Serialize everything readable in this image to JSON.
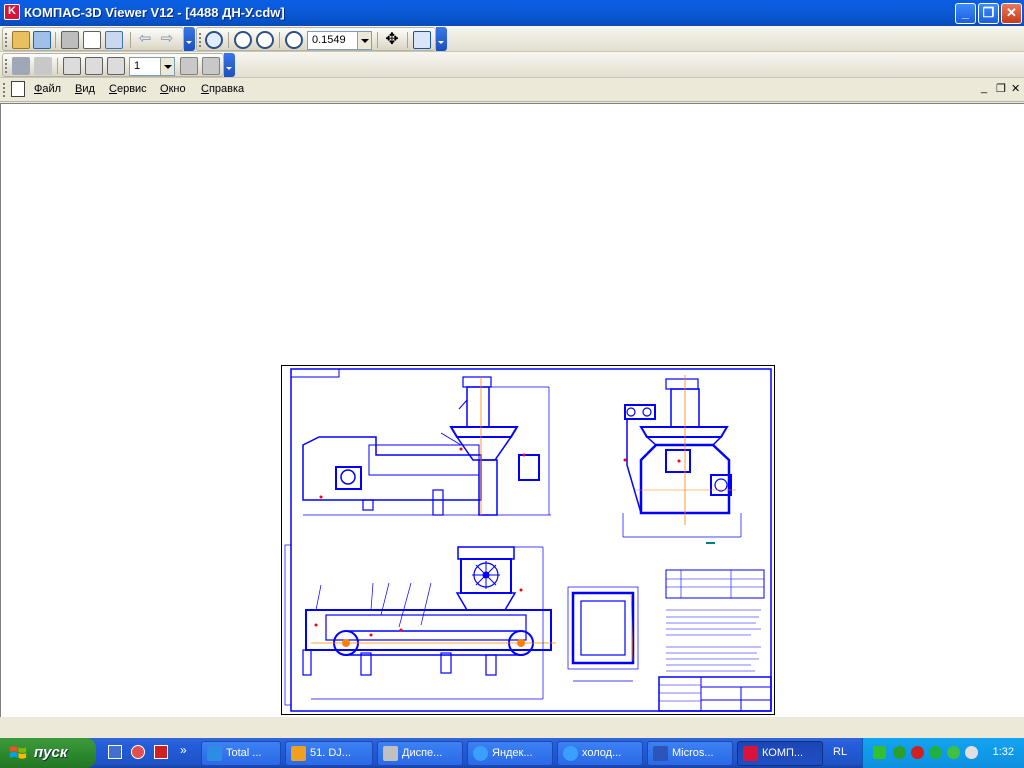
{
  "window": {
    "title": "КОМПАС-3D Viewer V12 - [4488 ДН-У.cdw]",
    "buttons": [
      "minimize",
      "maximize",
      "close"
    ]
  },
  "toolbar1": {
    "zoom_value": "0.1549",
    "icons": [
      "open-icon",
      "recent-icon",
      "print-icon",
      "preview-icon",
      "export-icon",
      "back-icon",
      "forward-icon",
      "zoom-window-icon",
      "zoom-in-icon",
      "zoom-out-icon",
      "zoom-scale-icon",
      "pan-icon",
      "refresh-icon"
    ]
  },
  "toolbar2": {
    "page_value": "1",
    "icons": [
      "pointer-icon",
      "eraser-icon",
      "layer-icon",
      "sheet-icon",
      "view-icon",
      "prev-sheet-icon",
      "next-sheet-icon"
    ]
  },
  "menu": {
    "items": [
      "Файл",
      "Вид",
      "Сервис",
      "Окно",
      "Справка"
    ]
  },
  "taskbar": {
    "start_label": "пуск",
    "language": "RL",
    "clock": "1:32",
    "tabs": [
      {
        "label": "Total ...",
        "icon": "total-commander-icon",
        "color": "#2d8de3"
      },
      {
        "label": "51. DJ...",
        "icon": "winamp-icon",
        "color": "#f0a020"
      },
      {
        "label": "Диспе...",
        "icon": "task-manager-icon",
        "color": "#c0c0c0"
      },
      {
        "label": "Яндек...",
        "icon": "ie-icon",
        "color": "#3aa0ff"
      },
      {
        "label": "холод...",
        "icon": "ie-icon",
        "color": "#3aa0ff"
      },
      {
        "label": "Micros...",
        "icon": "word-icon",
        "color": "#2b55b8"
      },
      {
        "label": "КОМП...",
        "icon": "kompas-icon",
        "color": "#d7143b"
      }
    ]
  },
  "colors": {
    "accent": "#0b5ad9",
    "drawing_line": "#0000ff",
    "drawing_axis": "#ff8000",
    "drawing_marker": "#ff0000"
  }
}
